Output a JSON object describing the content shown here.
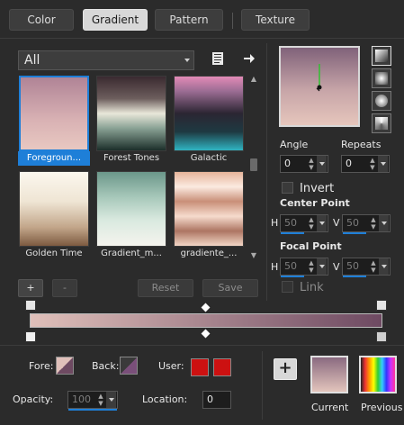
{
  "tabs": [
    {
      "label": "Color",
      "active": false
    },
    {
      "label": "Gradient",
      "active": true
    },
    {
      "label": "Pattern",
      "active": false
    },
    {
      "label": "Texture",
      "active": false
    }
  ],
  "filter": {
    "value": "All"
  },
  "icons": {
    "library": "library-book-icon",
    "arrow": "arrow-right-icon"
  },
  "gallery": [
    {
      "label": "Foregroun...",
      "selected": true,
      "colors": [
        "#b790a0",
        "#7c5a6e",
        "#e5c3bd"
      ]
    },
    {
      "label": "Forest Tones",
      "selected": false,
      "colors": [
        "#3a2f33",
        "#c9c7b5",
        "#22362f"
      ]
    },
    {
      "label": "Galactic",
      "selected": false,
      "colors": [
        "#dd77aa",
        "#2a2a38",
        "#2da7b3"
      ]
    },
    {
      "label": "Golden Time",
      "selected": false,
      "colors": [
        "#f5f0e6",
        "#c9b9a6",
        "#8e6a4f"
      ]
    },
    {
      "label": "Gradient_m...",
      "selected": false,
      "colors": [
        "#6f9a8d",
        "#cfe3d6",
        "#f2f0ea"
      ]
    },
    {
      "label": "gradiente_...",
      "selected": false,
      "colors": [
        "#e2aa8f",
        "#f8e6dc",
        "#b37a66"
      ]
    }
  ],
  "buttons": {
    "add": "+",
    "remove": "-",
    "reset": "Reset",
    "save": "Save"
  },
  "angle": {
    "label": "Angle",
    "value": "0"
  },
  "repeats": {
    "label": "Repeats",
    "value": "0"
  },
  "invert": {
    "label": "Invert",
    "checked": false
  },
  "center_point": {
    "label": "Center Point",
    "h_label": "H",
    "h_value": "50",
    "v_label": "V",
    "v_value": "50"
  },
  "focal_point": {
    "label": "Focal Point",
    "h_label": "H",
    "h_value": "50",
    "v_label": "V",
    "v_value": "50"
  },
  "link": {
    "label": "Link",
    "checked": false
  },
  "gradient": {
    "start_color": "#e0c0ba",
    "end_color": "#6e4a62"
  },
  "fore": {
    "label": "Fore:"
  },
  "back": {
    "label": "Back:"
  },
  "user": {
    "label": "User:",
    "color": "#cc1111"
  },
  "opacity": {
    "label": "Opacity:",
    "value": "100"
  },
  "location": {
    "label": "Location:",
    "value": "0"
  },
  "current": {
    "label": "Current"
  },
  "previous": {
    "label": "Previous"
  },
  "add_swatch": {
    "label": "+"
  }
}
